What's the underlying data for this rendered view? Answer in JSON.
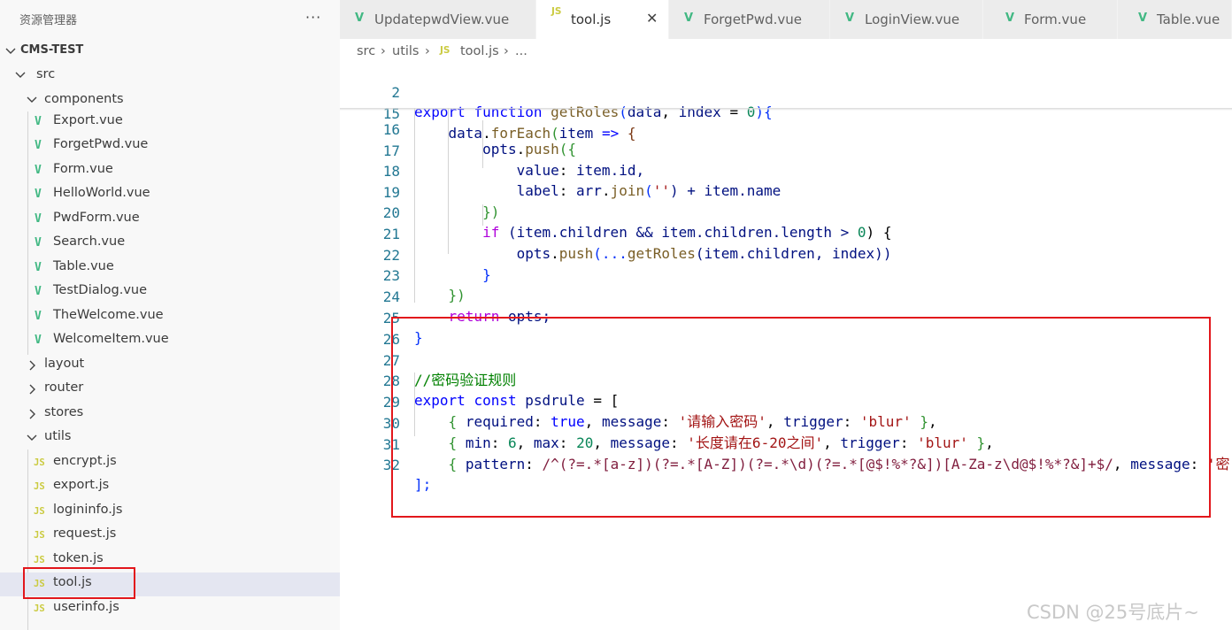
{
  "sidebar": {
    "title": "资源管理器",
    "more": "···",
    "project": "CMS-TEST",
    "folders": {
      "src": "src",
      "components": "components",
      "layout": "layout",
      "router": "router",
      "stores": "stores",
      "utils": "utils"
    },
    "components": [
      "Export.vue",
      "ForgetPwd.vue",
      "Form.vue",
      "HelloWorld.vue",
      "PwdForm.vue",
      "Search.vue",
      "Table.vue",
      "TestDialog.vue",
      "TheWelcome.vue",
      "WelcomeItem.vue"
    ],
    "utils": [
      "encrypt.js",
      "export.js",
      "logininfo.js",
      "request.js",
      "token.js",
      "tool.js",
      "userinfo.js"
    ],
    "selected_file": "tool.js"
  },
  "tabs": [
    {
      "label": "UpdatepwdView.vue",
      "icon": "vue-icon",
      "active": false
    },
    {
      "label": "tool.js",
      "icon": "js-icon",
      "active": true
    },
    {
      "label": "ForgetPwd.vue",
      "icon": "vue-icon",
      "active": false
    },
    {
      "label": "LoginView.vue",
      "icon": "vue-icon",
      "active": false
    },
    {
      "label": "Form.vue",
      "icon": "vue-icon",
      "active": false
    },
    {
      "label": "Table.vue",
      "icon": "vue-icon",
      "active": false
    }
  ],
  "tab_close": "✕",
  "breadcrumb": {
    "p1": "src",
    "p2": "utils",
    "p3": "tool.js",
    "p4": "...",
    "sep": "›",
    "js": "JS"
  },
  "icons": {
    "vue": "V",
    "js": "JS"
  },
  "editor": {
    "line_numbers": [
      "2",
      "15",
      "16",
      "17",
      "18",
      "19",
      "20",
      "21",
      "22",
      "23",
      "24",
      "25",
      "26",
      "27",
      "28",
      "29",
      "30",
      "31",
      "32"
    ],
    "tokens": {
      "export": "export",
      "function": "function",
      "getRoles": "getRoles",
      "params": "(data, index = ",
      "zero": "0",
      "paren_brace": "){",
      "data": "data",
      "forEach": "forEach",
      "item_arrow": "(item => {",
      "opts": "opts",
      "push": "push",
      "open_brace": "({",
      "value_key": "value",
      "item_id": "item.id,",
      "label_key": "label",
      "arr": "arr",
      "join": "join",
      "empty_str": "''",
      "plus_item_name": ") + item.name",
      "close_obj": "})",
      "if": "if",
      "cond1": " (item.children && item.children.length > ",
      "cond_end": ") {",
      "spread": "(...",
      "children_index": "(item.children, index))",
      "close_brace": "}",
      "close_all": "})",
      "return": "return",
      "opts_semi": "opts;",
      "comment": "//密码验证规则",
      "const": "const",
      "psdrule": "psdrule",
      "eq_bracket": " = [",
      "required": "required",
      "true": "true",
      "message": "message",
      "msg1": "'请输入密码'",
      "trigger": "trigger",
      "blur": "'blur'",
      "min": "min",
      "six": "6",
      "max": "max",
      "twenty": "20",
      "msg2": "'长度请在6-20之间'",
      "pattern": "pattern",
      "regex": "/^(?=.*[a-z])(?=.*[A-Z])(?=.*\\d)(?=.*[@$!%*?&])[A-Za-z\\d@$!%*?&]+$/",
      "msg3_start": "'密",
      "close_array": "];"
    }
  },
  "watermark": "CSDN @25号底片~"
}
